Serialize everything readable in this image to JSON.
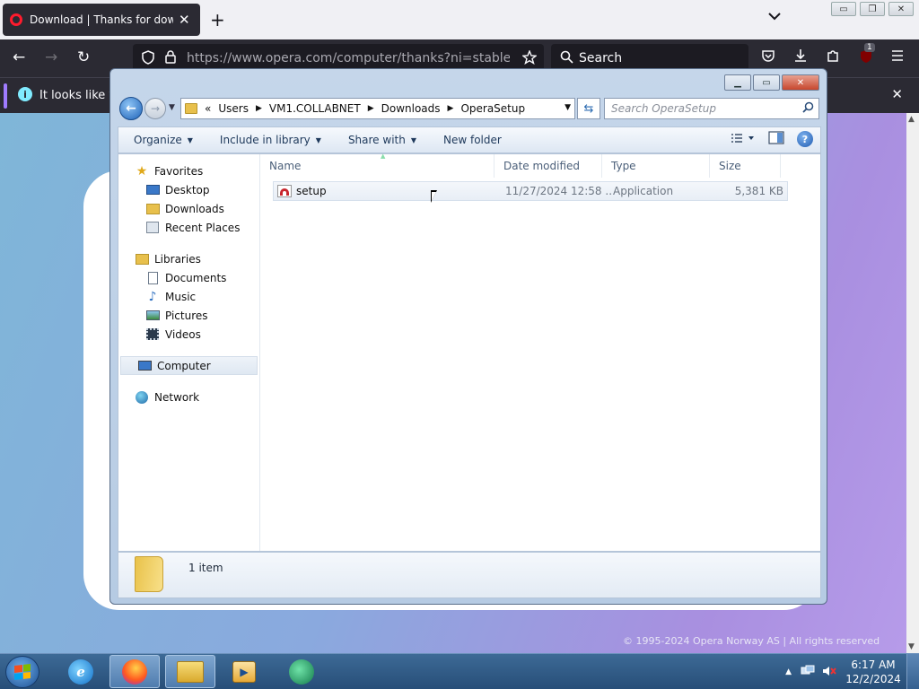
{
  "browser": {
    "tab": {
      "title": "Download | Thanks for downloading Opera",
      "close": "✕"
    },
    "new_tab": "+",
    "tab_list": "⌄",
    "window_buttons": {
      "minimize": "▭",
      "maximize": "❐",
      "close": "✕"
    },
    "nav": {
      "back": "←",
      "forward": "→",
      "reload": "↻"
    },
    "url": "https://www.opera.com/computer/thanks?ni=stable&os=windows",
    "search_placeholder": "Search",
    "extension_badge": "1",
    "infobar_text": "It looks like you",
    "infobar_close": "✕",
    "page_copyright": "© 1995-2024 Opera Norway AS | All rights reserved"
  },
  "explorer": {
    "window_buttons": {
      "minimize": "▁",
      "maximize": "▭",
      "close": "✕"
    },
    "breadcrumb": {
      "prefix": "«",
      "items": [
        "Users",
        "VM1.COLLABNET",
        "Downloads",
        "OperaSetup"
      ]
    },
    "search_placeholder": "Search OperaSetup",
    "toolbar": {
      "organize": "Organize",
      "include_in_library": "Include in library",
      "share_with": "Share with",
      "new_folder": "New folder"
    },
    "navpane": {
      "favorites": {
        "label": "Favorites",
        "items": [
          "Desktop",
          "Downloads",
          "Recent Places"
        ]
      },
      "libraries": {
        "label": "Libraries",
        "items": [
          "Documents",
          "Music",
          "Pictures",
          "Videos"
        ]
      },
      "computer": "Computer",
      "network": "Network"
    },
    "columns": [
      "Name",
      "Date modified",
      "Type",
      "Size"
    ],
    "files": [
      {
        "name": "setup",
        "date_modified": "11/27/2024 12:58 ...",
        "type": "Application",
        "size": "5,381 KB"
      }
    ],
    "details": {
      "item_count": "1 item"
    }
  },
  "taskbar": {
    "clock": {
      "time": "6:17 AM",
      "date": "12/2/2024"
    }
  },
  "colors": {
    "browser_dark": "#2b2a33",
    "explorer_frame": "#c5d6ea",
    "taskbar": "#274e78",
    "opera_red": "#c8262d"
  }
}
